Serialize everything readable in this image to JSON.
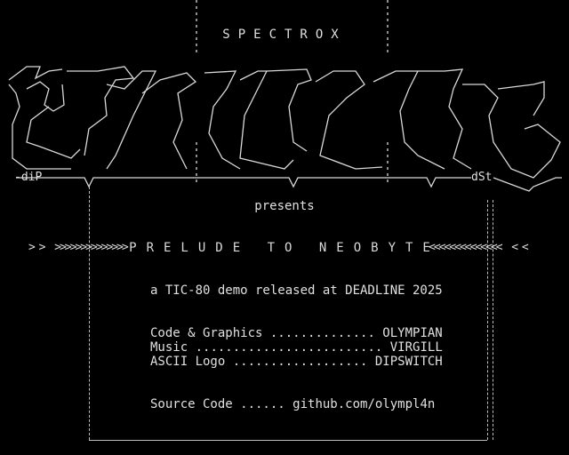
{
  "group_name": "SPECTROX",
  "presents": "presents",
  "title": "PRELUDE TO NEOBYTE",
  "left_chevrons": "> >  >>>>>>>>>>>>>>",
  "right_chevrons": "<<<<<<<<<<<<<<  < <",
  "signatures": {
    "left": "-diP",
    "right": "dSt"
  },
  "intro_line": "a TIC-80 demo released at DEADLINE 2025",
  "credits": [
    {
      "role": "Code & Graphics",
      "dots": " ..............",
      "name": " OLYMPIAN"
    },
    {
      "role": "Music",
      "dots": " .........................",
      "name": " VIRGILL"
    },
    {
      "role": "ASCII Logo",
      "dots": " ..................",
      "name": " DIPSWITCH"
    }
  ],
  "source": {
    "label": "Source Code",
    "dots": " ......",
    "url": " github.com/olympl4n"
  },
  "colors": {
    "background": "#000000",
    "foreground": "#d9d9d9"
  }
}
